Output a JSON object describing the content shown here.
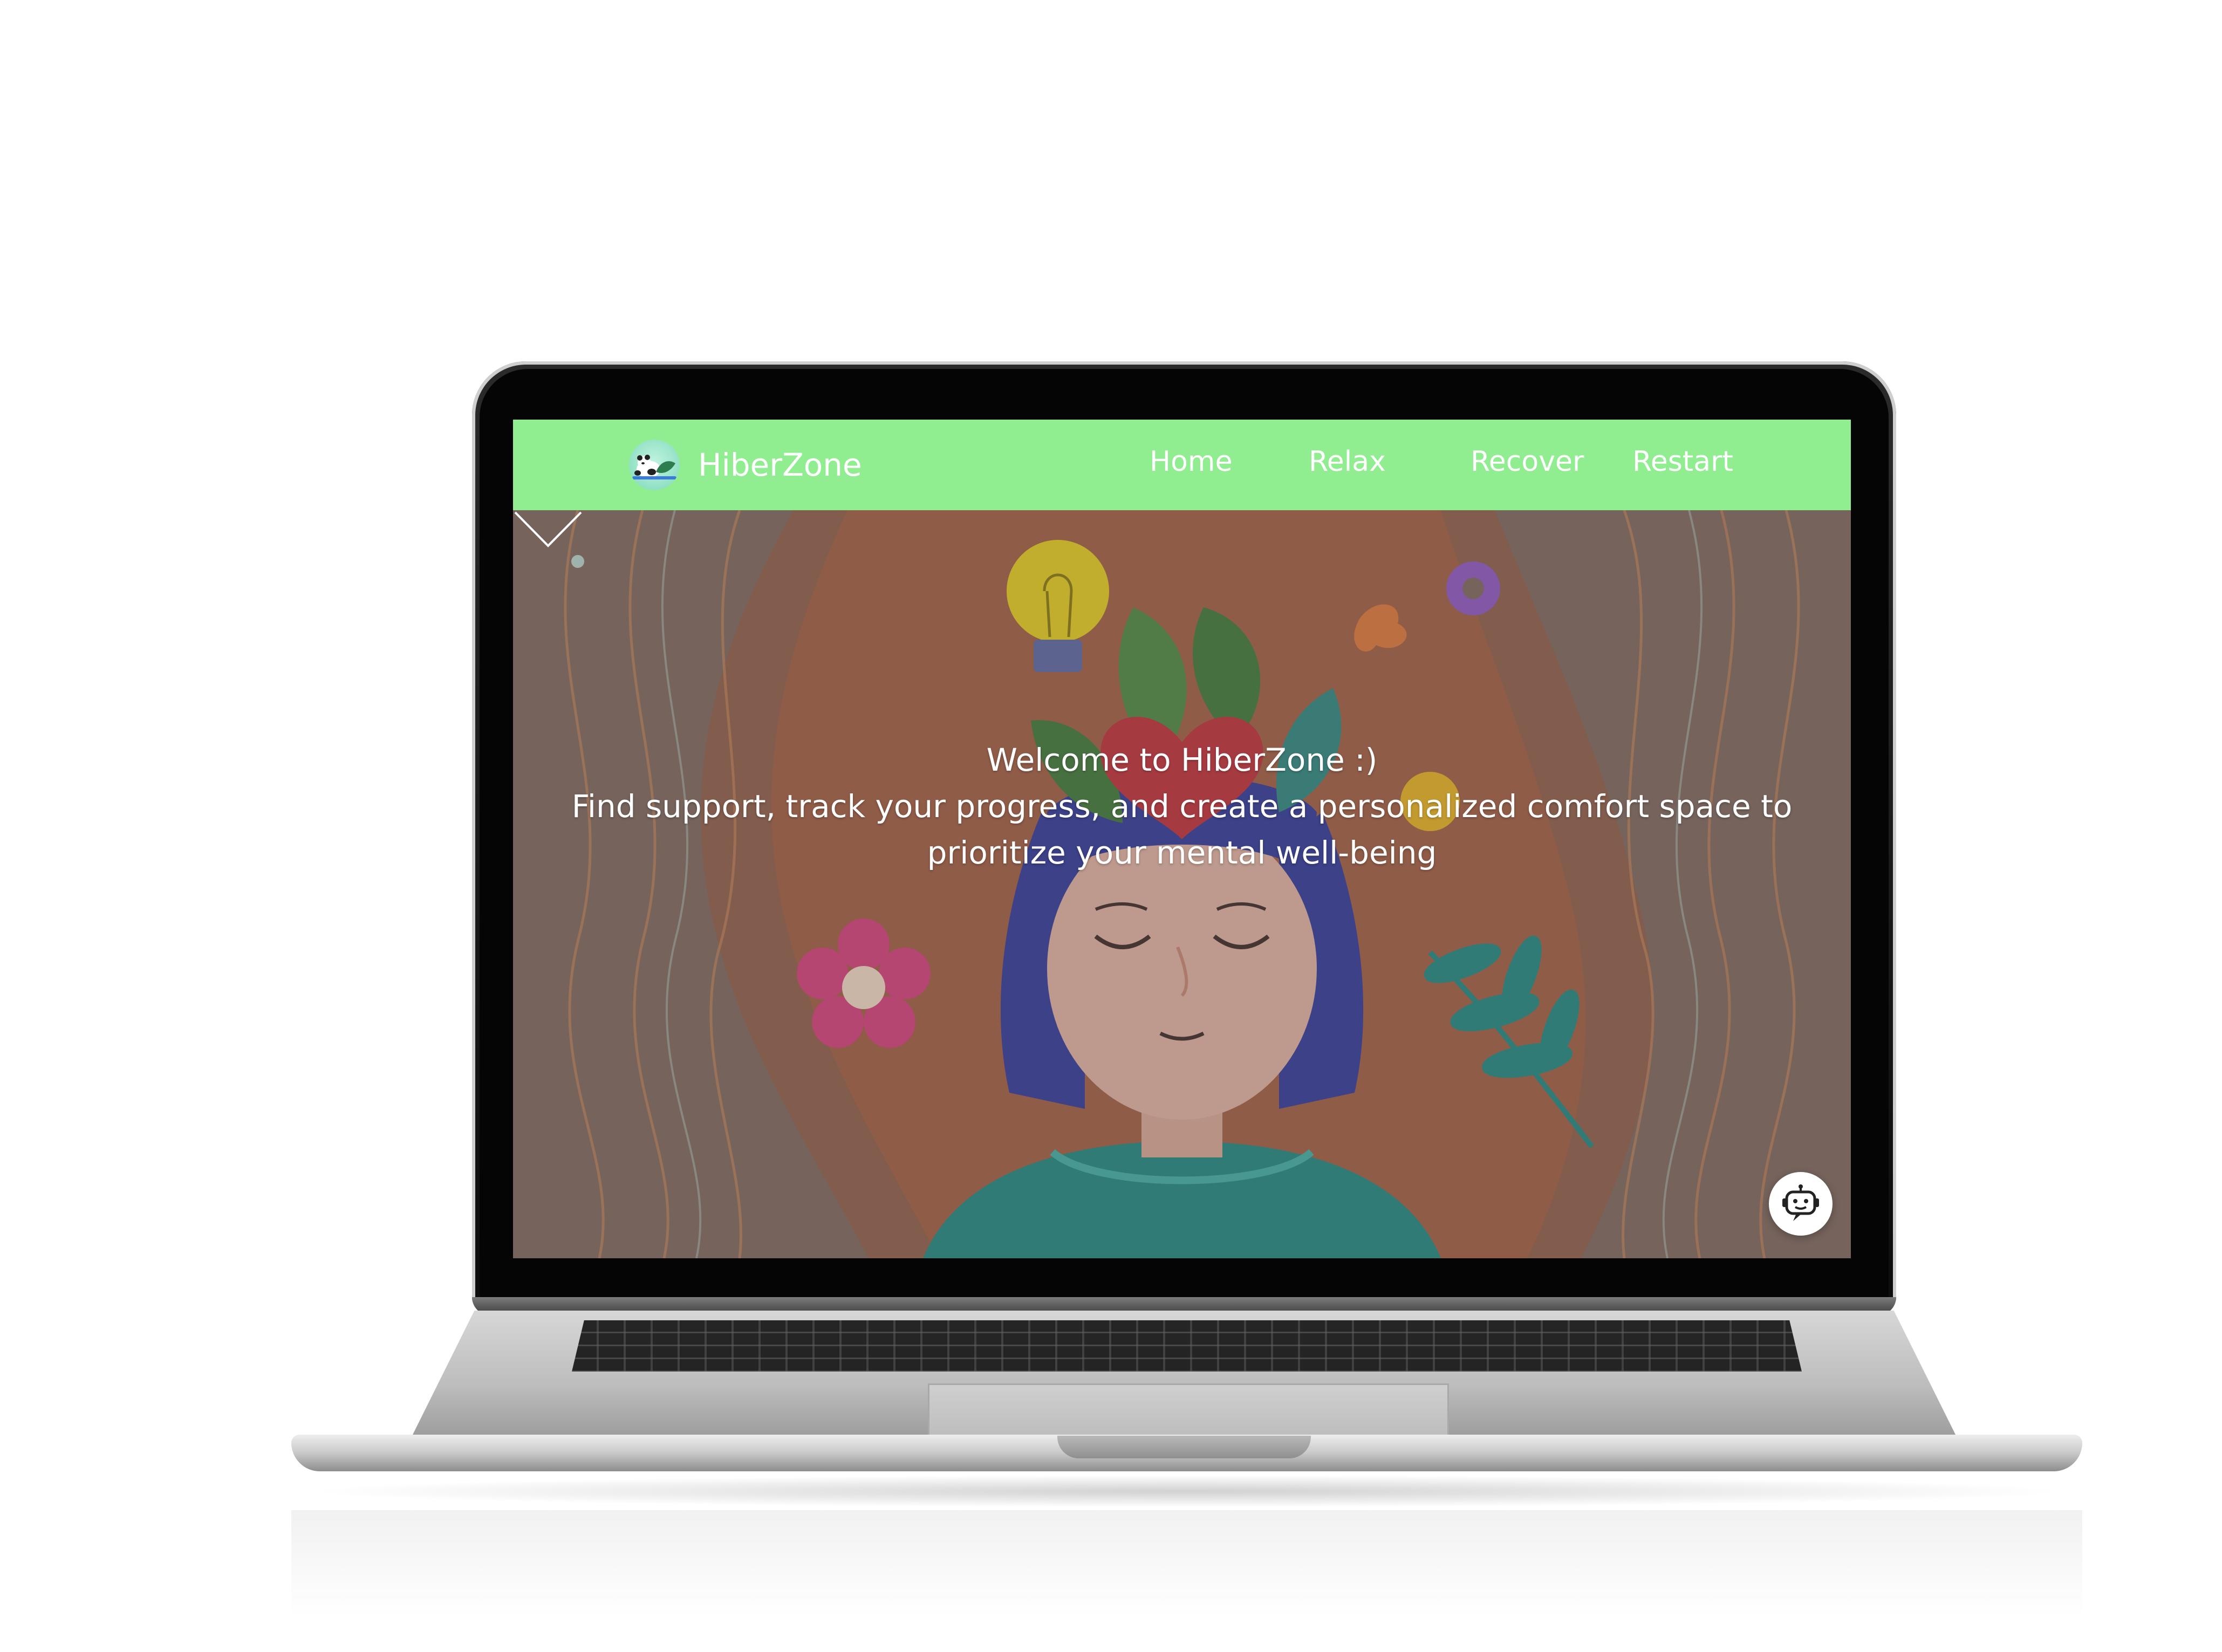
{
  "app": {
    "brand_name": "HiberZone",
    "logo_icon": "sleeping-panda-logo-icon"
  },
  "nav": {
    "items": [
      {
        "label": "Home"
      },
      {
        "label": "Relax"
      },
      {
        "label": "Recover"
      },
      {
        "label": "Restart"
      }
    ]
  },
  "hero": {
    "line1": "Welcome to HiberZone :)",
    "line2": "Find support, track your progress, and create a personalized comfort space to",
    "line3": "prioritize your mental well-being",
    "illustration": "woman-with-closed-eyes-and-blooming-mind-illustration",
    "scroll_icon": "chevron-down-icon"
  },
  "chatbot": {
    "icon": "chatbot-robot-icon"
  },
  "colors": {
    "navbar": "#90ee90",
    "hero_background": "#7d6961",
    "text": "#ffffff"
  }
}
